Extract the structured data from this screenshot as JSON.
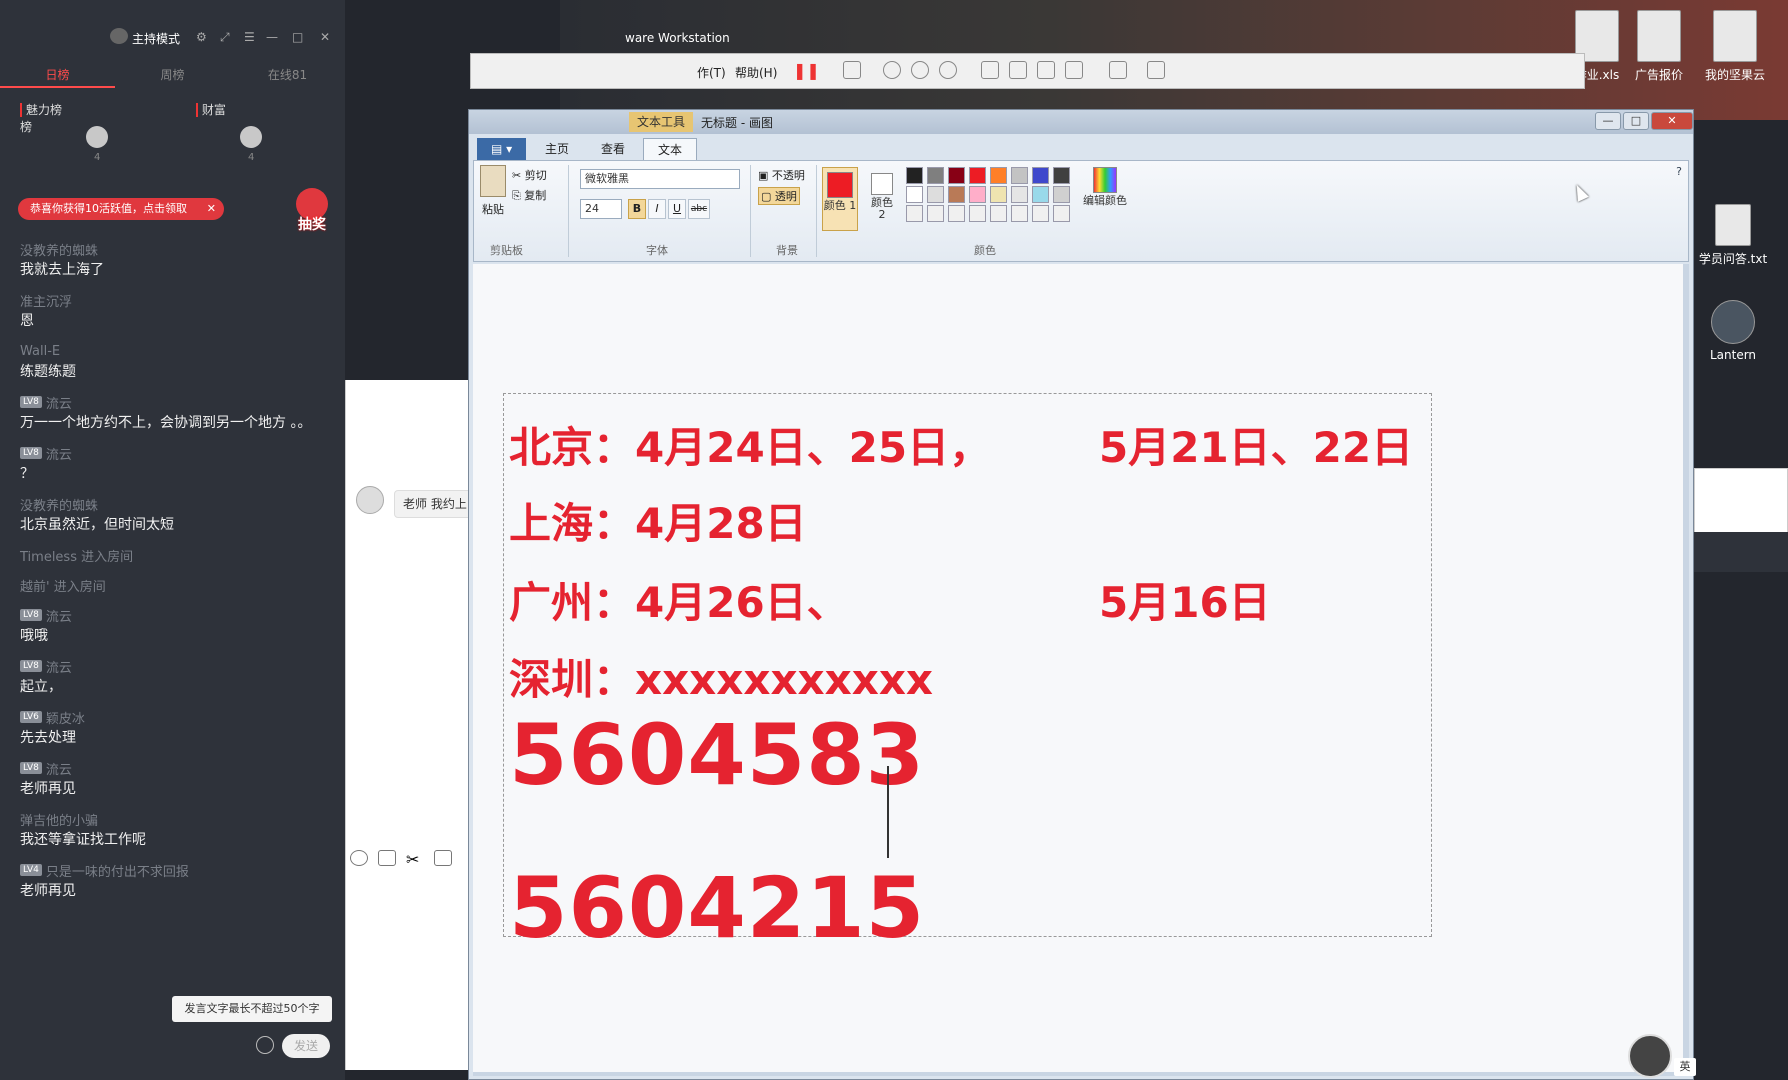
{
  "live_panel": {
    "host_mode": "主持模式",
    "rank_tabs": [
      "日榜",
      "周榜",
      "在线81"
    ],
    "sub_tabs": [
      "魅力榜",
      "财富榜"
    ],
    "medals": [
      "4",
      "4"
    ],
    "gift_banner": "恭喜你获得10活跃值，点击领取",
    "lottery": "抽奖",
    "messages": [
      {
        "user": "没教养的蜘蛛",
        "level": "",
        "text": "我就去上海了"
      },
      {
        "user": "准主沉浮",
        "level": "",
        "text": "恩"
      },
      {
        "user": "Wall-E",
        "level": "",
        "text": "练题练题"
      },
      {
        "user": "流云",
        "level": "LV8",
        "text": "万一一个地方约不上，会协调到另一个地方 。。"
      },
      {
        "user": "流云",
        "level": "LV8",
        "text": "？"
      },
      {
        "user": "没教养的蜘蛛",
        "level": "",
        "text": "北京虽然近，但时间太短"
      },
      {
        "user": "Timeless 进入房间",
        "level": "",
        "text": ""
      },
      {
        "user": "越前' 进入房间",
        "level": "",
        "text": ""
      },
      {
        "user": "流云",
        "level": "LV8",
        "text": "哦哦"
      },
      {
        "user": "流云",
        "level": "LV8",
        "text": "起立，"
      },
      {
        "user": "颖皮冰",
        "level": "LV6",
        "text": "先去处理"
      },
      {
        "user": "流云",
        "level": "LV8",
        "text": "老师再见"
      },
      {
        "user": "弹吉他的小骗",
        "level": "",
        "text": "我还等拿证找工作呢"
      },
      {
        "user": "只是一味的付出不求回报",
        "level": "LV4",
        "text": "老师再见"
      }
    ],
    "tooltip": "发言文字最长不超过50个字",
    "send_label": "发送"
  },
  "mid_window": {
    "bubble_text": "老师 我约上"
  },
  "vmware": {
    "title": "ware Workstation",
    "menu": [
      "作(T)",
      "帮助(H)"
    ]
  },
  "paint": {
    "context_tab": "文本工具",
    "doc_title": "无标题 - 画图",
    "ribbon_tabs": [
      "主页",
      "查看",
      "文本"
    ],
    "clipboard": {
      "paste": "粘贴",
      "cut": "剪切",
      "copy": "复制",
      "label": "剪贴板"
    },
    "font": {
      "name": "微软雅黑",
      "size": "24",
      "label": "字体",
      "bold": "B",
      "italic": "I",
      "underline": "U",
      "strike": "abc"
    },
    "background": {
      "opaque": "不透明",
      "transparent": "透明",
      "label": "背景"
    },
    "colors": {
      "color1": "颜色 1",
      "color2": "颜色 2",
      "edit": "编辑颜色",
      "label": "颜色",
      "color1_hex": "#ed1c24",
      "color2_hex": "#ffffff"
    },
    "palette": [
      "#222222",
      "#7f7f7f",
      "#880015",
      "#ed1c24",
      "#ff7f27",
      "#c3c3c3",
      "#3f48cc",
      "#404040",
      "#ffffff",
      "#dddddd",
      "#b97a57",
      "#ffaec9",
      "#efe4b0",
      "#e5e5e5",
      "#99d9ea",
      "#d0d0d0",
      "#f0f0f0",
      "#f0f0f0",
      "#f0f0f0",
      "#f0f0f0",
      "#f0f0f0",
      "#f0f0f0",
      "#f0f0f0",
      "#f0f0f0"
    ],
    "text_lines": {
      "beijing": "北京：4月24日、25日，",
      "beijing_may": "5月21日、22日",
      "shanghai": "上海：4月28日",
      "guangzhou": "广州：4月26日、",
      "guangzhou_may": "5月16日",
      "shenzhen": "深圳：xxxxxxxxxxx",
      "num1": "5604583",
      "num2": "5604215"
    },
    "text_color": "#e52330"
  },
  "desktop": {
    "icons": [
      "作业.xls",
      "广告报价",
      "我的坚果云",
      "学员问答.txt",
      "Lantern"
    ]
  },
  "taskbar": {
    "ime": "英"
  }
}
